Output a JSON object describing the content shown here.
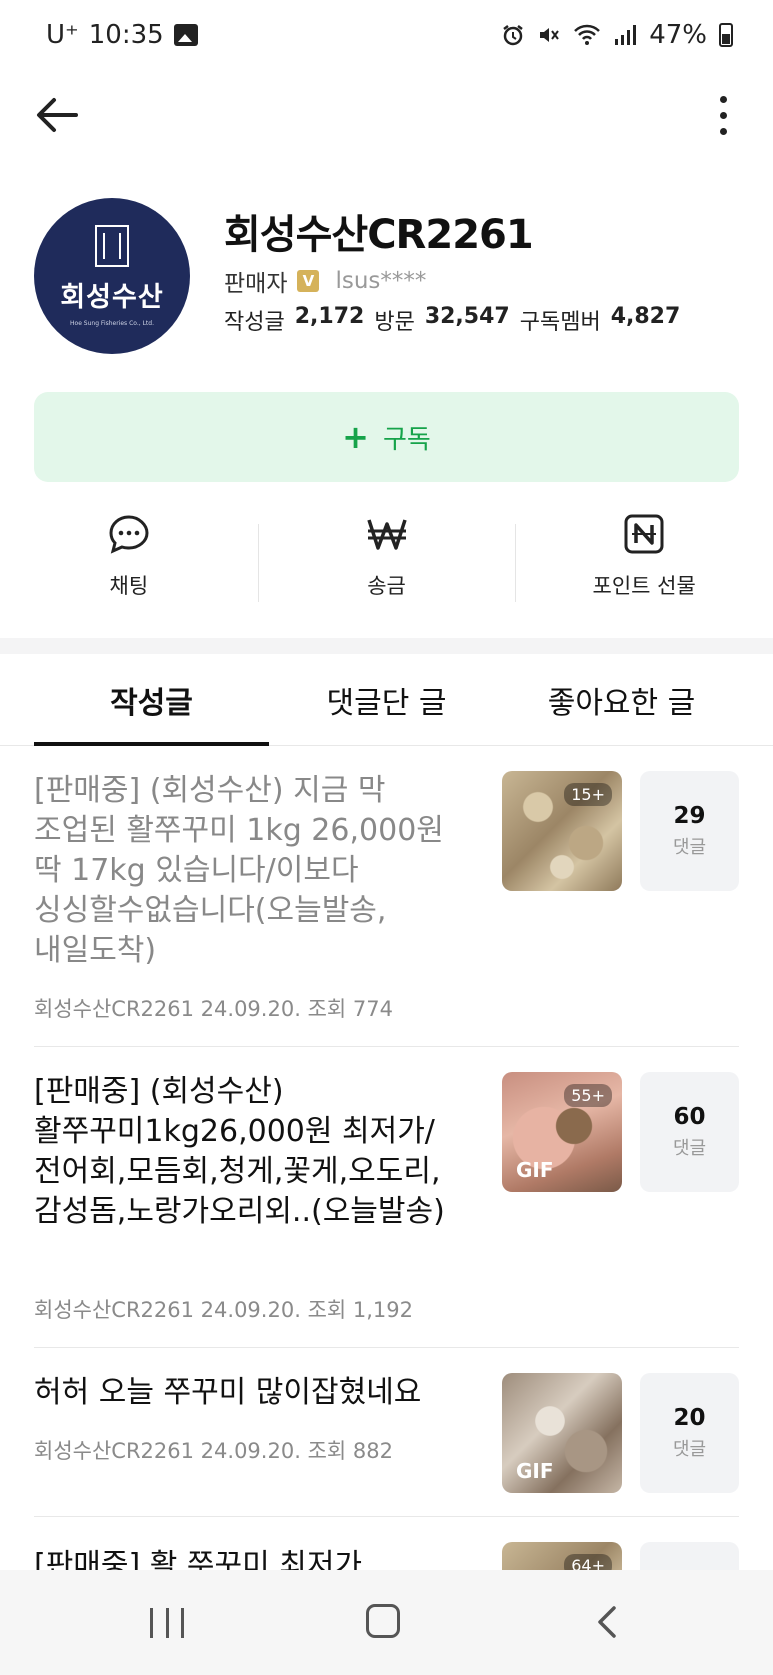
{
  "status_bar": {
    "carrier": "U⁺",
    "time": "10:35",
    "battery": "47%",
    "icons": [
      "image-icon",
      "alarm-icon",
      "mute-icon",
      "wifi-icon",
      "signal-icon",
      "battery-icon"
    ]
  },
  "profile": {
    "name": "회성수산CR2261",
    "avatar_text": "회성수산",
    "avatar_subtext": "Hoe Sung Fisheries Co., Ltd.",
    "role": "판매자",
    "verified_badge": "V",
    "user_id": "lsus****",
    "stats": {
      "posts_label": "작성글",
      "posts": "2,172",
      "visits_label": "방문",
      "visits": "32,547",
      "members_label": "구독멤버",
      "members": "4,827"
    }
  },
  "subscribe": {
    "plus": "+",
    "label": "구독"
  },
  "actions": {
    "chat": "채팅",
    "transfer": "송금",
    "point_gift": "포인트 선물"
  },
  "tabs": {
    "posts": "작성글",
    "commented": "댓글단 글",
    "liked": "좋아요한 글"
  },
  "posts": [
    {
      "title": "[판매중] (회성수산) 지금 막 조업된 활쭈꾸미 1kg 26,000원 딱 17kg 있습니다/이보다 싱싱할수없습니다(오늘발송,내일도착)",
      "author": "회성수산CR2261",
      "date": "24.09.20.",
      "views_label": "조회",
      "views": "774",
      "thumb_count": "15+",
      "comments": "29",
      "comments_label": "댓글"
    },
    {
      "title": "[판매중] (회성수산) 활쭈꾸미1kg26,000원 최저가/전어회,모듬회,청게,꽃게,오도리,감성돔,노랑가오리외..(오늘발송)",
      "author": "회성수산CR2261",
      "date": "24.09.20.",
      "views_label": "조회",
      "views": "1,192",
      "thumb_count": "55+",
      "gif": "GIF",
      "comments": "60",
      "comments_label": "댓글"
    },
    {
      "title": "허허 오늘 쭈꾸미 많이잡혔네요",
      "author": "회성수산CR2261",
      "date": "24.09.20.",
      "views_label": "조회",
      "views": "882",
      "gif": "GIF",
      "comments": "20",
      "comments_label": "댓글"
    },
    {
      "title": "[판매중] 활 쭈꾸미 최저가",
      "thumb_count": "64+"
    }
  ]
}
